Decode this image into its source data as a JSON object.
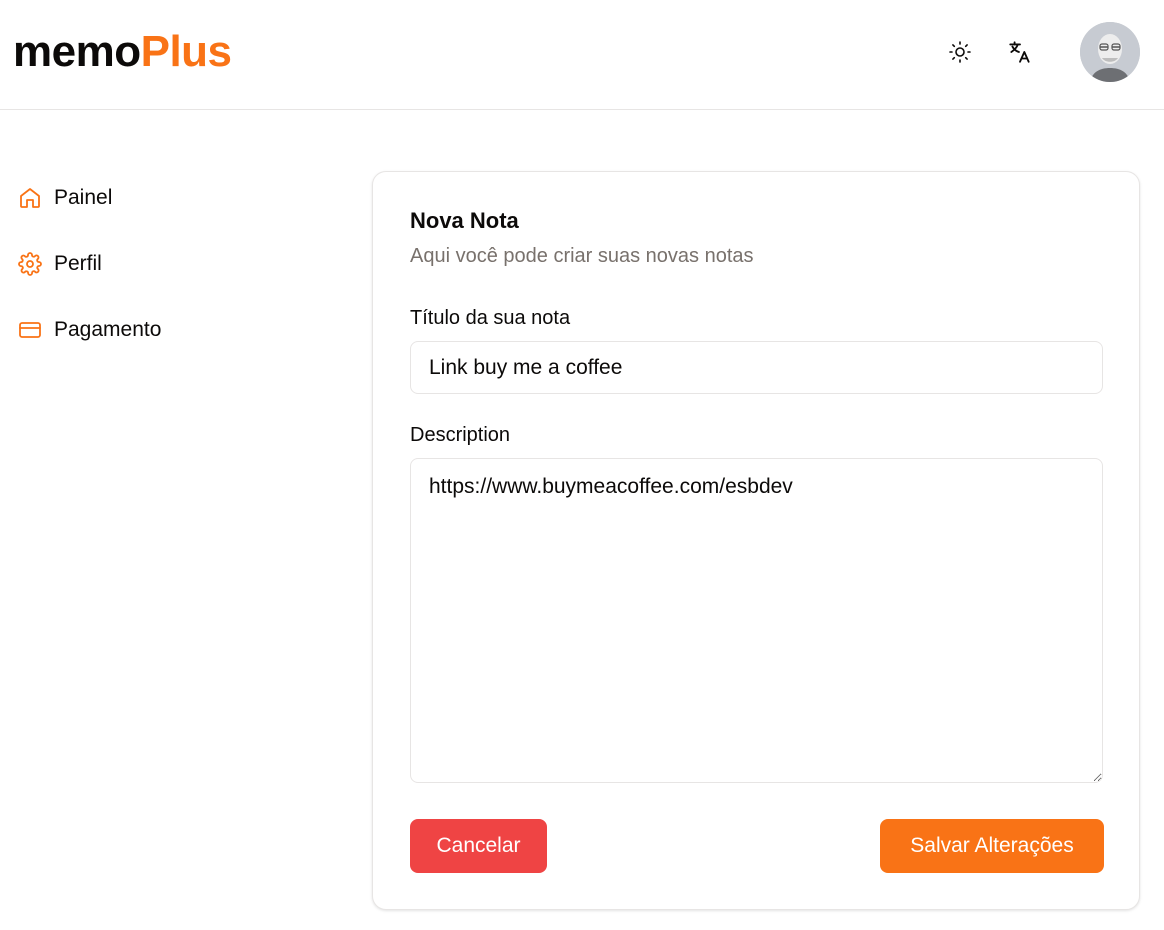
{
  "app": {
    "logo_part1": "memo",
    "logo_part2": "Plus"
  },
  "header": {
    "theme_icon": "sun-icon",
    "language_icon": "translate-icon",
    "avatar_icon": "user-avatar"
  },
  "sidebar": {
    "items": [
      {
        "label": "Painel",
        "icon": "home-icon"
      },
      {
        "label": "Perfil",
        "icon": "gear-icon"
      },
      {
        "label": "Pagamento",
        "icon": "credit-card-icon"
      }
    ]
  },
  "form": {
    "title": "Nova Nota",
    "subtitle": "Aqui você pode criar suas novas notas",
    "title_field": {
      "label": "Título da sua nota",
      "value": "Link buy me a coffee"
    },
    "description_field": {
      "label": "Description",
      "value": "https://www.buymeacoffee.com/esbdev"
    },
    "cancel_label": "Cancelar",
    "save_label": "Salvar Alterações"
  },
  "colors": {
    "accent": "#f97316",
    "danger": "#ef4444",
    "muted_text": "#78716c",
    "border": "#e7e5e4"
  }
}
